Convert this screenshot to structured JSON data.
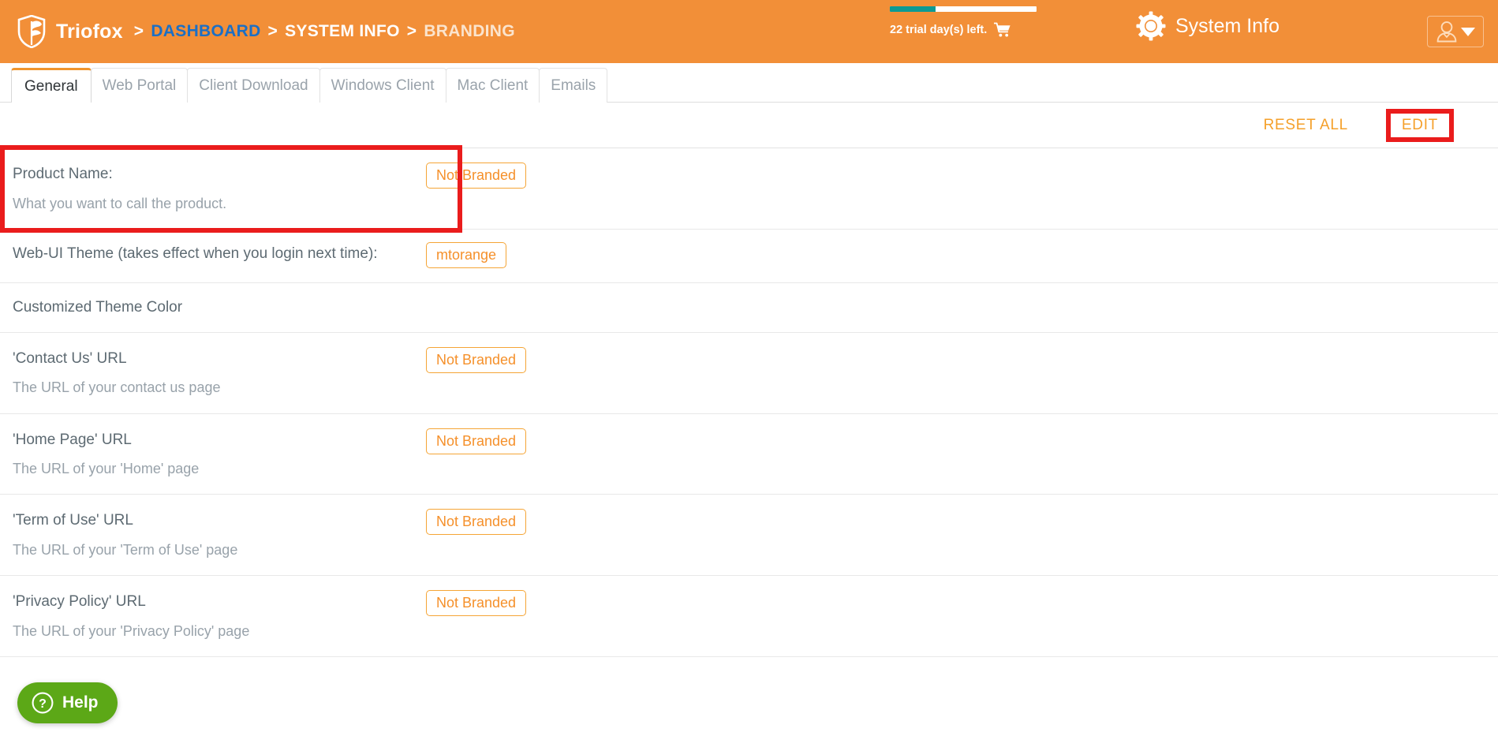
{
  "header": {
    "brand_name": "Triofox",
    "logo_icon": "shield-icon",
    "breadcrumb": {
      "separator": ">",
      "items": [
        {
          "label": "DASHBOARD",
          "style": "link"
        },
        {
          "label": "SYSTEM INFO",
          "style": "plain"
        },
        {
          "label": "BRANDING",
          "style": "current"
        }
      ]
    },
    "trial": {
      "text": "22 trial day(s) left.",
      "progress_percent": 31,
      "bar_fill_color": "#0d9a93",
      "bar_track_color": "#ffffff",
      "cart_icon": "shopping-cart-icon"
    },
    "system_info": {
      "label": "System Info",
      "icon": "gear-icon"
    },
    "user_menu": {
      "avatar_icon": "user-icon",
      "caret_icon": "chevron-down-icon"
    },
    "background_color": "#f28f38"
  },
  "tabs": [
    {
      "label": "General",
      "active": true
    },
    {
      "label": "Web Portal",
      "active": false
    },
    {
      "label": "Client Download",
      "active": false
    },
    {
      "label": "Windows Client",
      "active": false
    },
    {
      "label": "Mac Client",
      "active": false
    },
    {
      "label": "Emails",
      "active": false
    }
  ],
  "actions": {
    "reset_all_label": "RESET ALL",
    "edit_label": "EDIT",
    "accent_color": "#f5a02a",
    "highlight_color": "#ea1c1c"
  },
  "settings_rows": [
    {
      "title": "Product Name:",
      "description": "What you want to call the product.",
      "value": "Not Branded",
      "highlighted": true
    },
    {
      "title": "Web-UI Theme (takes effect when you login next time):",
      "description": "",
      "value": "mtorange",
      "highlighted": false
    },
    {
      "title": "Customized Theme Color",
      "description": "",
      "value": "",
      "highlighted": false
    },
    {
      "title": "'Contact Us' URL",
      "description": "The URL of your contact us page",
      "value": "Not Branded",
      "highlighted": false
    },
    {
      "title": "'Home Page' URL",
      "description": "The URL of your 'Home' page",
      "value": "Not Branded",
      "highlighted": false
    },
    {
      "title": "'Term of Use' URL",
      "description": "The URL of your 'Term of Use' page",
      "value": "Not Branded",
      "highlighted": false
    },
    {
      "title": "'Privacy Policy' URL",
      "description": "The URL of your 'Privacy Policy' page",
      "value": "Not Branded",
      "highlighted": false
    }
  ],
  "help_widget": {
    "label": "Help",
    "icon": "question-mark-icon",
    "color": "#5ca817"
  }
}
